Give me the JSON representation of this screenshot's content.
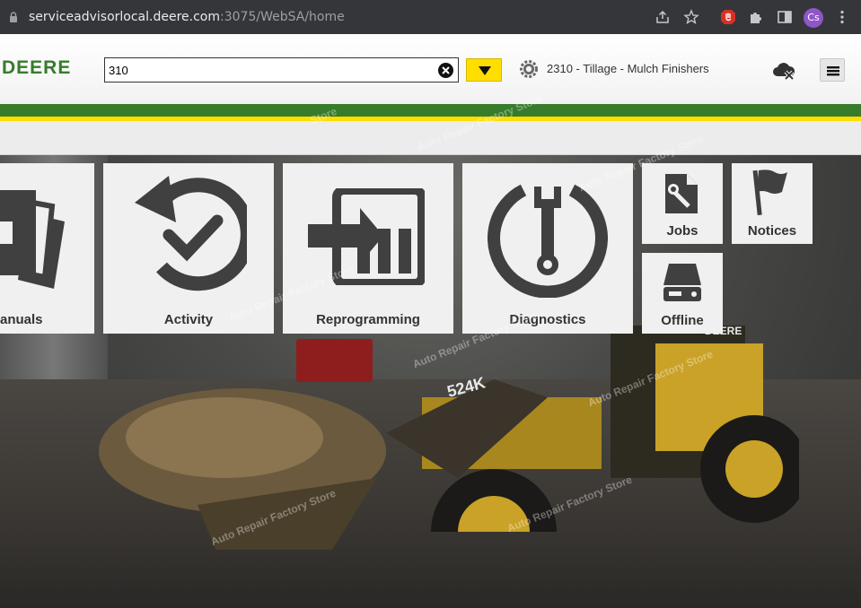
{
  "browser": {
    "url_host": "serviceadvisorlocal.deere.com",
    "url_path": ":3075/WebSA/home",
    "profile_initials": "Cs"
  },
  "header": {
    "logo_text": "DEERE",
    "search_value": "310",
    "machine_label": "2310 - Tillage - Mulch Finishers"
  },
  "tiles": {
    "manuals_label": "anuals",
    "activity_label": "Activity",
    "reprogramming_label": "Reprogramming",
    "diagnostics_label": "Diagnostics",
    "jobs_label": "Jobs",
    "notices_label": "Notices",
    "offline_label": "Offline"
  },
  "scene": {
    "loader_model": "524K",
    "loader_brand": "DEERE"
  },
  "watermarks": [
    "Store",
    "Auto Repair Factory Store",
    "Auto Repair Factory Store",
    "Auto Repair Factory Store",
    "Auto Repair Factory Store",
    "Auto Repair Factory Store",
    "Auto Repair Factory Store"
  ],
  "colors": {
    "deere_green": "#367c2b",
    "deere_yellow": "#ffde00",
    "tile_bg": "#f0f0f0",
    "icon_dark": "#404040"
  }
}
